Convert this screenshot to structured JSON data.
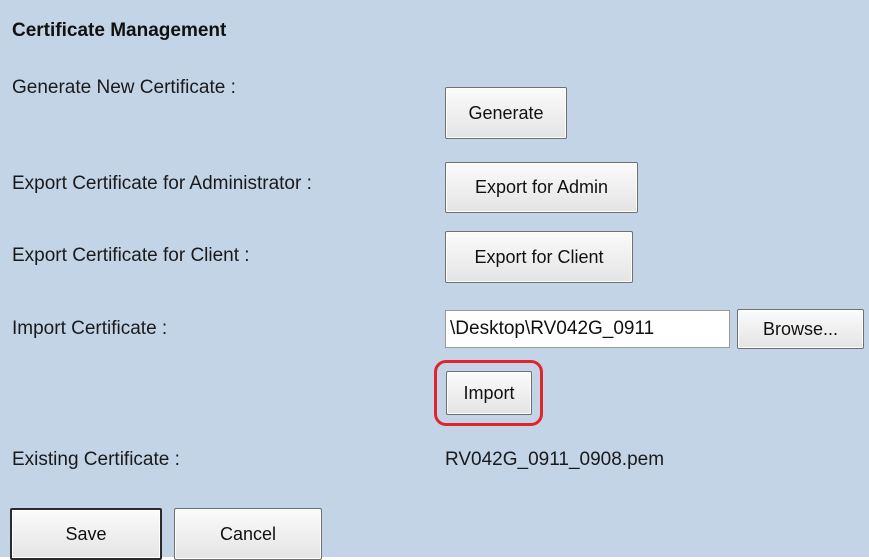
{
  "section": {
    "title": "Certificate Management"
  },
  "rows": {
    "generate": {
      "label": "Generate New Certificate :",
      "button": "Generate"
    },
    "export_admin": {
      "label": "Export Certificate for Administrator :",
      "button": "Export for Admin"
    },
    "export_client": {
      "label": "Export Certificate for Client :",
      "button": "Export for Client"
    },
    "import": {
      "label": "Import Certificate :",
      "file_value": "\\Desktop\\RV042G_0911",
      "browse_button": "Browse...",
      "import_button": "Import"
    },
    "existing": {
      "label": "Existing Certificate :",
      "value": "RV042G_0911_0908.pem"
    }
  },
  "footer": {
    "save_label": "Save",
    "cancel_label": "Cancel"
  },
  "colors": {
    "panel_background": "#c3d4e6",
    "highlight": "#e0242c"
  }
}
